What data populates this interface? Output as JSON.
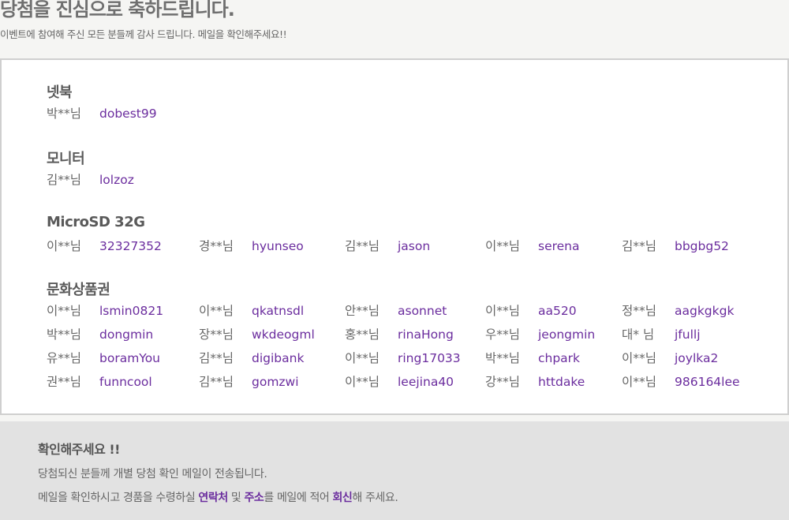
{
  "header": {
    "title": "당첨을 진심으로 축하드립니다.",
    "subtitle": "이벤트에 참여해 주신 모든 분들께 감사 드립니다. 메일을 확인해주세요!!"
  },
  "categories": [
    {
      "title": "넷북",
      "winners": [
        {
          "name": "박**님",
          "id": "dobest99"
        }
      ]
    },
    {
      "title": "모니터",
      "winners": [
        {
          "name": "김**님",
          "id": "lolzoz"
        }
      ]
    },
    {
      "title": "MicroSD 32G",
      "winners": [
        {
          "name": "이**님",
          "id": "32327352"
        },
        {
          "name": "경**님",
          "id": "hyunseo"
        },
        {
          "name": "김**님",
          "id": "jason"
        },
        {
          "name": "이**님",
          "id": "serena"
        },
        {
          "name": "김**님",
          "id": "bbgbg52"
        }
      ]
    },
    {
      "title": "문화상품권",
      "winners": [
        {
          "name": "이**님",
          "id": "lsmin0821"
        },
        {
          "name": "이**님",
          "id": "qkatnsdl"
        },
        {
          "name": "안**님",
          "id": "asonnet"
        },
        {
          "name": "이**님",
          "id": "aa520"
        },
        {
          "name": "정**님",
          "id": "aagkgkgk"
        },
        {
          "name": "박**님",
          "id": "dongmin"
        },
        {
          "name": "장**님",
          "id": "wkdeogml"
        },
        {
          "name": "홍**님",
          "id": "rinaHong"
        },
        {
          "name": "우**님",
          "id": "jeongmin"
        },
        {
          "name": "대* 님",
          "id": "jfullj"
        },
        {
          "name": "유**님",
          "id": "boramYou"
        },
        {
          "name": "김**님",
          "id": "digibank"
        },
        {
          "name": "이**님",
          "id": "ring17033"
        },
        {
          "name": "박**님",
          "id": "chpark"
        },
        {
          "name": "이**님",
          "id": "joylka2"
        },
        {
          "name": "권**님",
          "id": "funncool"
        },
        {
          "name": "김**님",
          "id": "gomzwi"
        },
        {
          "name": "이**님",
          "id": "leejina40"
        },
        {
          "name": "강**님",
          "id": "httdake"
        },
        {
          "name": "이**님",
          "id": "986164lee"
        }
      ]
    }
  ],
  "notice": {
    "title": "확인해주세요 !!",
    "line1": "당첨되신 분들께 개별 당첨 확인 메일이 전송됩니다.",
    "line2_a": "메일을 확인하시고 경품을 수령하실 ",
    "line2_contact": "연락처",
    "line2_b": " 및 ",
    "line2_address": "주소",
    "line2_c": "를 메일에 적어 ",
    "line2_reply": "회신",
    "line2_d": "해 주세요."
  }
}
